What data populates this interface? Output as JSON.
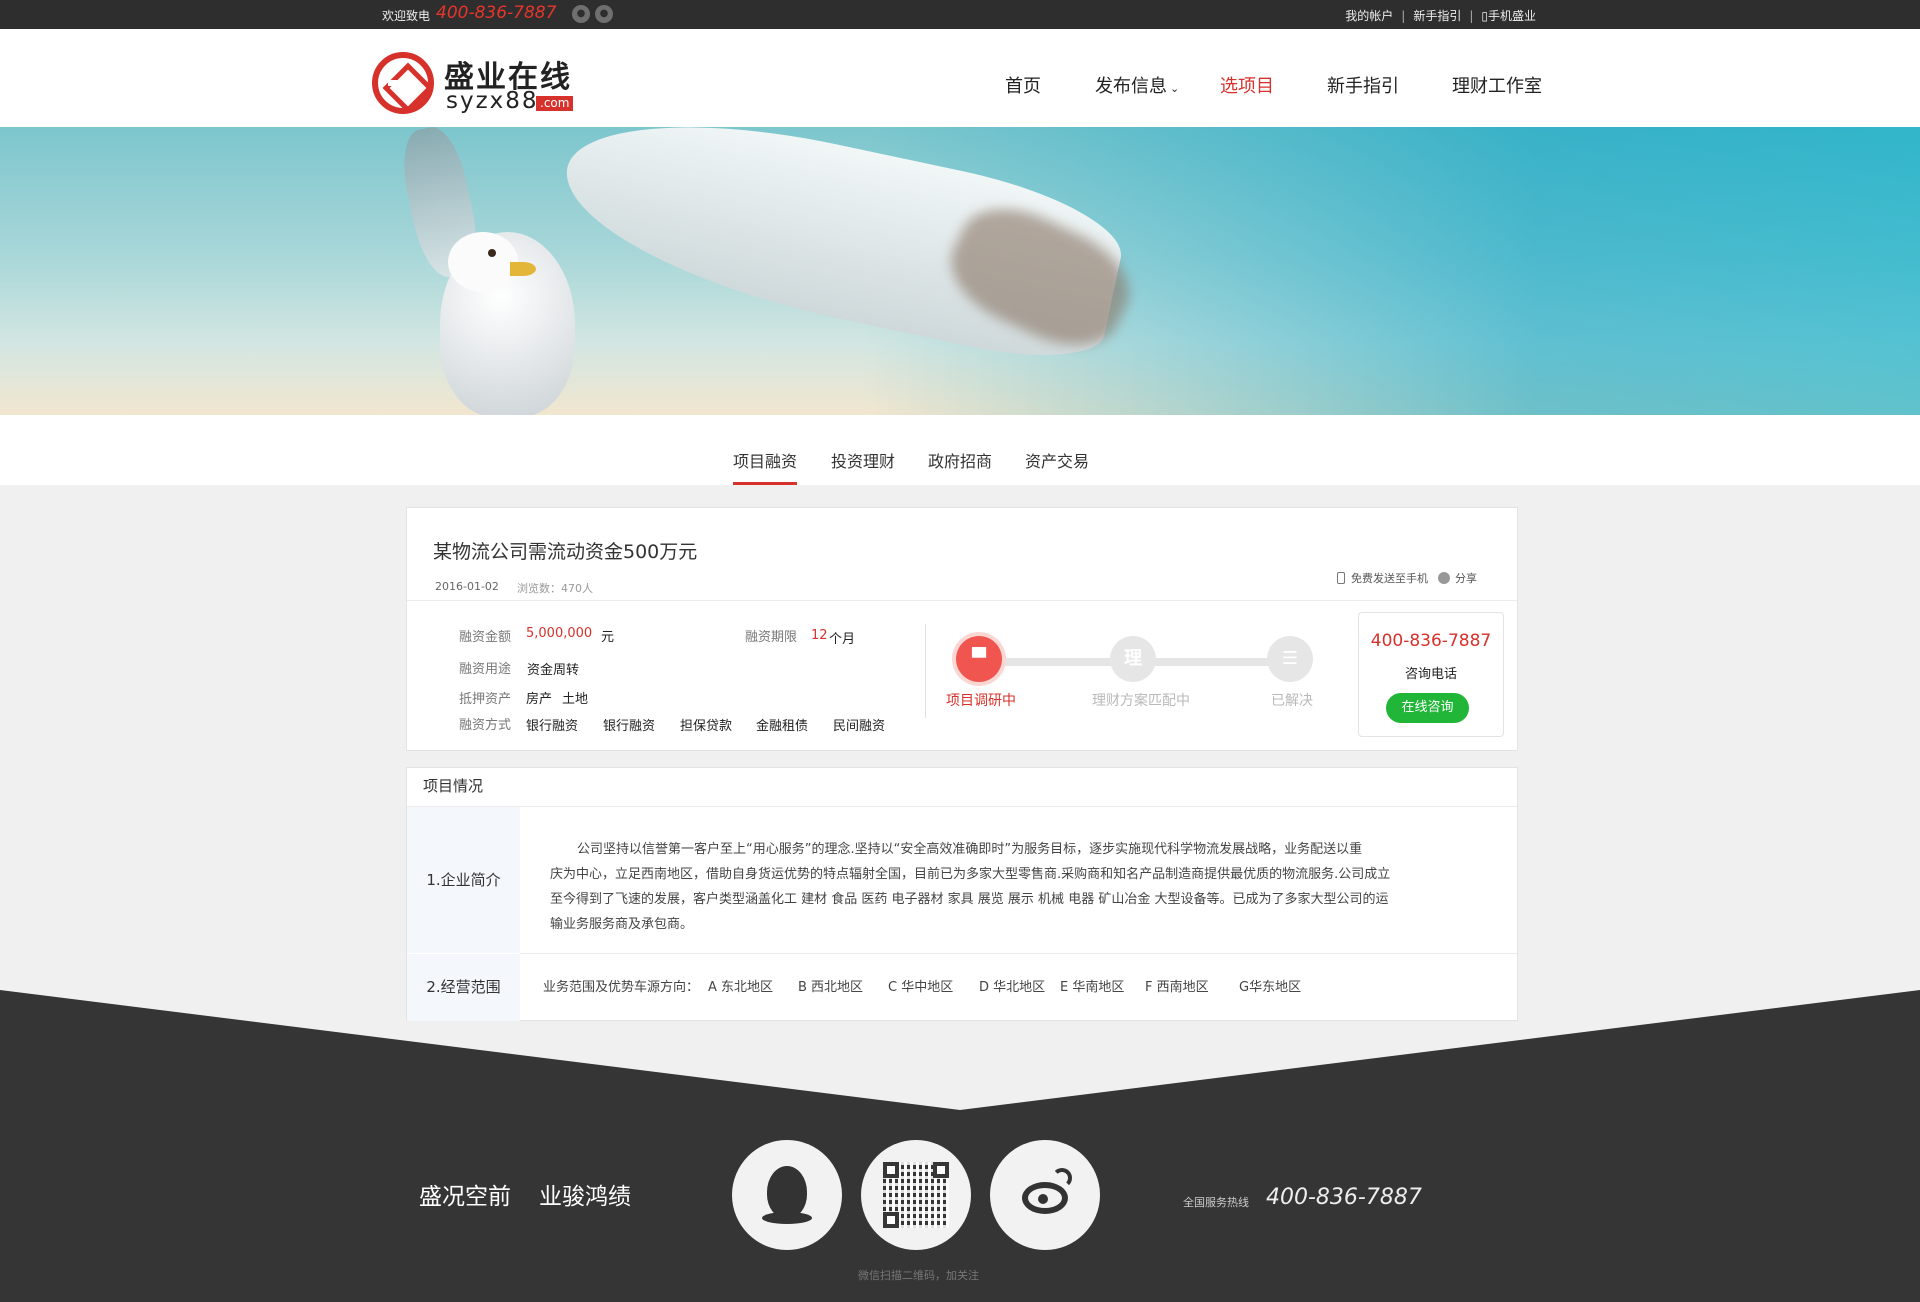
{
  "topbar": {
    "welcome": "欢迎致电",
    "phone": "400-836-7887",
    "icons": [
      "wechat-icon",
      "qq-icon"
    ],
    "links": [
      "我的帐户",
      "新手指引",
      "手机盛业"
    ]
  },
  "logo": {
    "cn": "盛业在线",
    "en": "syzx88",
    "domain": ".com"
  },
  "nav": [
    {
      "label": "首页",
      "active": false
    },
    {
      "label": "发布信息",
      "active": false,
      "has_dropdown": true
    },
    {
      "label": "选项目",
      "active": true
    },
    {
      "label": "新手指引",
      "active": false
    },
    {
      "label": "理财工作室",
      "active": false
    }
  ],
  "subtabs": [
    "项目融资",
    "投资理财",
    "政府招商",
    "资产交易"
  ],
  "subtabs_active": "项目融资",
  "project": {
    "title": "某物流公司需流动资金500万元",
    "date": "2016-01-02",
    "views": "浏览数：470人",
    "send_phone": "免费发送至手机",
    "share": "分享",
    "amount_label": "融资金额",
    "amount": "5,000,000",
    "amount_unit": "元",
    "term_label": "融资期限",
    "term": "12",
    "term_unit": "个月",
    "use_label": "融资用途",
    "use": "资金周转",
    "collateral_label": "抵押资产",
    "collateral": [
      "房产",
      "土地"
    ],
    "methods_label": "融资方式",
    "methods": [
      "银行融资",
      "银行融资",
      "担保贷款",
      "金融租债",
      "民间融资"
    ],
    "progress": [
      {
        "label": "项目调研中",
        "icon": "research-icon",
        "active": true
      },
      {
        "label": "理财方案匹配中",
        "glyph": "理",
        "active": false
      },
      {
        "label": "已解决",
        "icon": "list-icon",
        "active": false
      }
    ],
    "contact": {
      "tel": "400-836-7887",
      "label": "咨询电话",
      "button": "在线咨询"
    }
  },
  "details": {
    "section_title": "项目情况",
    "intro_label": "1.企业简介",
    "intro_lines": [
      "公司坚持以信誉第一客户至上“用心服务”的理念.坚持以“安全高效准确即时”为服务目标，逐步实施现代科学物流发展战略，业务配送以重",
      "庆为中心，立足西南地区，借助自身货运优势的特点辐射全国，目前已为多家大型零售商.采购商和知名产品制造商提供最优质的物流服务.公司成立",
      "至今得到了飞速的发展，客户类型涵盖化工 建材 食品 医药 电子器材 家具 展览 展示 机械 电器 矿山冶金 大型设备等。已成为了多家大型公司的运",
      "输业务服务商及承包商。"
    ],
    "scope_label": "2.经营范围",
    "scope_prefix": "业务范围及优势车源方向：",
    "scope_items": [
      "A 东北地区",
      "B 西北地区",
      "C 华中地区",
      "D 华北地区",
      "E 华南地区",
      "F 西南地区",
      "G华东地区"
    ]
  },
  "footer": {
    "slogan1": "盛况空前",
    "slogan2": "业骏鸿绩",
    "qr_caption": "微信扫描二维码，加关注",
    "hotline_label": "全国服务热线",
    "hotline": "400-836-7887"
  }
}
